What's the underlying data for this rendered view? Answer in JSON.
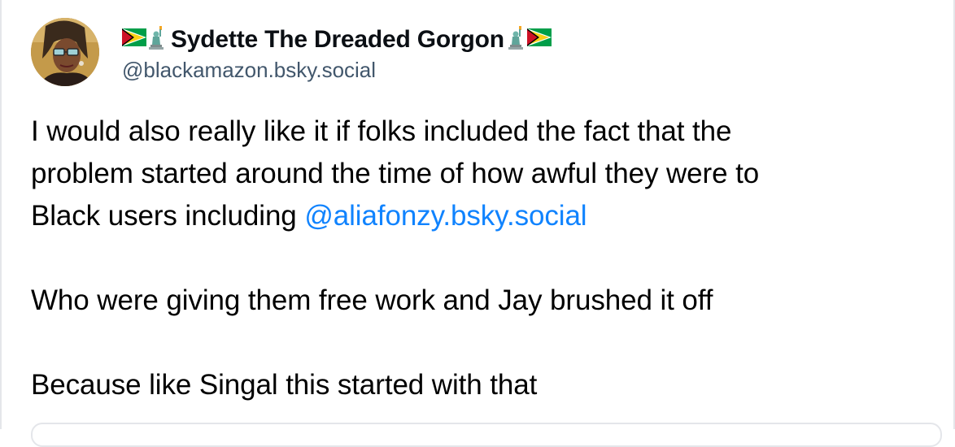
{
  "author": {
    "display_name": "Sydette The Dreaded Gorgon",
    "handle": "@blackamazon.bsky.social",
    "name_emojis": [
      "guyana-flag-icon",
      "statue-of-liberty-icon"
    ]
  },
  "post": {
    "line1": "I would also really like it if folks included the fact that the",
    "line2": "problem started around the time of how awful they were to",
    "line3_prefix": "Black users including ",
    "mention": "@aliafonzy.bsky.social",
    "para2": "Who were giving them free work and Jay brushed it off",
    "para3": "Because like Singal this started with that"
  },
  "colors": {
    "link": "#1083fe",
    "handle": "#42576c",
    "border": "#e4e6ea"
  }
}
